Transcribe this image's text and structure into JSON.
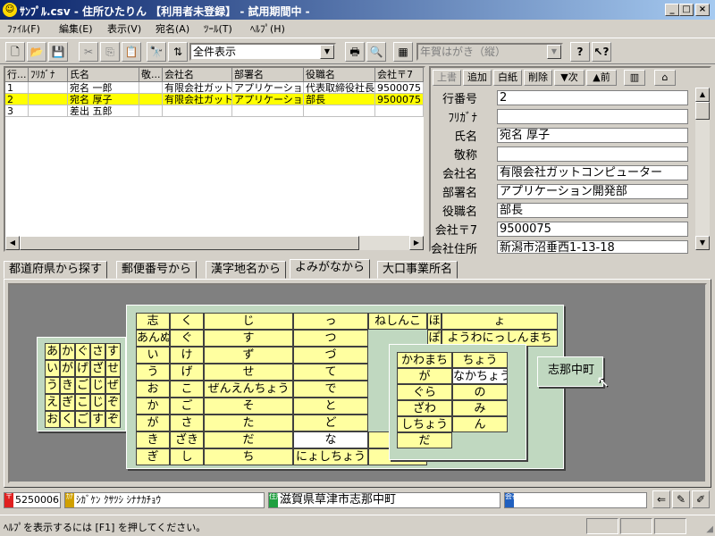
{
  "window": {
    "title": "ｻﾝﾌﾟﾙ.csv - 住所ひたりん 【利用者未登録】 - 試用期間中 -",
    "app_icon": "☺"
  },
  "menu": [
    "ﾌｧｲﾙ(F)",
    "編集(E)",
    "表示(V)",
    "宛名(A)",
    "ﾂｰﾙ(T)",
    "ﾍﾙﾌﾟ(H)"
  ],
  "toolbar": {
    "filter_value": "全件表示",
    "print_layout_value": "年賀はがき（縦）"
  },
  "grid": {
    "headers": [
      "行...",
      "ﾌﾘｶﾞﾅ",
      "氏名",
      "敬...",
      "会社名",
      "部署名",
      "役職名",
      "会社〒7"
    ],
    "rows": [
      [
        "1",
        "",
        "宛名 一郎",
        "",
        "有限会社ガット",
        "アプリケーション開",
        "代表取締役社長",
        "9500075"
      ],
      [
        "2",
        "",
        "宛名 厚子",
        "",
        "有限会社ガット",
        "アプリケーション開",
        "部長",
        "9500075"
      ],
      [
        "3",
        "",
        "差出 五郎",
        "",
        "",
        "",
        "",
        ""
      ]
    ]
  },
  "detail": {
    "buttons": [
      "上書",
      "追加",
      "白紙",
      "削除",
      "▼次",
      "▲前"
    ],
    "fields": [
      {
        "label": "行番号",
        "value": "2"
      },
      {
        "label": "ﾌﾘｶﾞﾅ",
        "value": ""
      },
      {
        "label": "氏名",
        "value": "宛名 厚子"
      },
      {
        "label": "敬称",
        "value": ""
      },
      {
        "label": "会社名",
        "value": "有限会社ガットコンピューター"
      },
      {
        "label": "部署名",
        "value": "アプリケーション開発部"
      },
      {
        "label": "役職名",
        "value": "部長"
      },
      {
        "label": "会社〒7",
        "value": "9500075"
      },
      {
        "label": "会社住所",
        "value": "新潟市沼垂西1-13-18"
      }
    ]
  },
  "tabs": [
    "都道府県から探す",
    "郵便番号から",
    "漢字地名から",
    "よみがなから",
    "大口事業所名"
  ],
  "active_tab": 3,
  "kana_panel1": [
    [
      "あ",
      "か",
      "ぐ",
      "さ",
      "す"
    ],
    [
      "い",
      "が",
      "げ",
      "ざ",
      "せ"
    ],
    [
      "う",
      "き",
      "ご",
      "じ",
      "ぜ"
    ],
    [
      "え",
      "ぎ",
      "こ",
      "じ",
      "ぞ"
    ],
    [
      "お",
      "く",
      "ご",
      "す",
      "ぞ"
    ]
  ],
  "kana_panel2": {
    "col1": [
      "志",
      "あんぬ",
      "い",
      "う",
      "お",
      "か",
      "が",
      "き",
      "ぎ"
    ],
    "col2": [
      "く",
      "ぐ",
      "け",
      "げ",
      "こ",
      "ご",
      "さ",
      "ざき",
      "し"
    ],
    "col3": [
      "じ",
      "す",
      "ず",
      "せ",
      "ぜんえんちょう",
      "そ",
      "た",
      "だ",
      "ち"
    ],
    "col4": [
      "っ",
      "つ",
      "づ",
      "て",
      "で",
      "と",
      "ど",
      "な",
      "にょしちょう"
    ],
    "col5": [
      "ねしんこ",
      "の",
      "",
      "",
      "",
      "",
      "",
      "へ",
      ""
    ],
    "col6": [
      "ほ",
      "ぽ",
      "",
      "",
      "",
      "",
      "",
      "",
      ""
    ],
    "col7": [
      "ょ",
      "ようわにっしんまち",
      "",
      "",
      "",
      "",
      "",
      "",
      ""
    ]
  },
  "kana_panel3": {
    "col1": [
      "かわまち",
      "が",
      "ぐら",
      "ざわ",
      "しちょう",
      "だ"
    ],
    "col2": [
      "ちょう",
      "なかちょう",
      "の",
      "み",
      "ん",
      ""
    ]
  },
  "result": {
    "value": "志那中町"
  },
  "status": {
    "zip": "5250006",
    "kana_tag": "ｶﾅ",
    "kana": "ｼｶﾞｹﾝ ｸｻﾂｼ ｼﾅﾅｶﾁｮｳ",
    "addr_tag": "住所",
    "address": "滋賀県草津市志那中町",
    "company_tag": "会社",
    "company": "",
    "help": "ﾍﾙﾌﾟを表示するには [F1] を押してください。"
  },
  "colors": {
    "highlight_row": "#ffff00",
    "title_start": "#0a246a",
    "title_end": "#a6caf0",
    "kana_cell": "#ffffa0",
    "panel": "#c0d8c0"
  }
}
